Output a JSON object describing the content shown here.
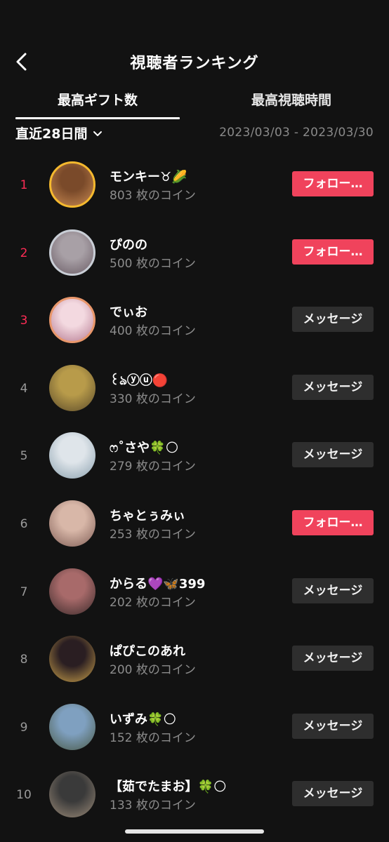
{
  "header": {
    "title": "視聴者ランキング",
    "back_icon": "chevron-left-icon"
  },
  "tabs": [
    {
      "label": "最高ギフト数",
      "active": true
    },
    {
      "label": "最高視聴時間",
      "active": false
    }
  ],
  "filter": {
    "period_label": "直近28日間",
    "date_range": "2023/03/03 - 2023/03/30"
  },
  "colors": {
    "accent": "#fe2c55",
    "follow_button": "#f0435c",
    "message_button": "#2e2e2e",
    "background": "#121212"
  },
  "rows": [
    {
      "rank": "1",
      "name": "モンキー♉🌽",
      "coins": "803 枚のコイン",
      "button": "フォロー…",
      "button_type": "follow",
      "avatar_ring": "gold"
    },
    {
      "rank": "2",
      "name": "ぴのの",
      "coins": "500 枚のコイン",
      "button": "フォロー…",
      "button_type": "follow",
      "avatar_ring": "silver"
    },
    {
      "rank": "3",
      "name": "でぃお",
      "coins": "400 枚のコイン",
      "button": "メッセージ",
      "button_type": "message",
      "avatar_ring": "bronze"
    },
    {
      "rank": "4",
      "name": "꒰ঌⓨⓤ🔴",
      "coins": "330 枚のコイン",
      "button": "メッセージ",
      "button_type": "message",
      "avatar_ring": ""
    },
    {
      "rank": "5",
      "name": "ෆ˚さや🍀🌕",
      "coins": "279 枚のコイン",
      "button": "メッセージ",
      "button_type": "message",
      "avatar_ring": ""
    },
    {
      "rank": "6",
      "name": "ちゃとぅみぃ",
      "coins": "253 枚のコイン",
      "button": "フォロー…",
      "button_type": "follow",
      "avatar_ring": ""
    },
    {
      "rank": "7",
      "name": "からる💜🦋399",
      "coins": "202 枚のコイン",
      "button": "メッセージ",
      "button_type": "message",
      "avatar_ring": ""
    },
    {
      "rank": "8",
      "name": "ぱぴこのあれ",
      "coins": "200 枚のコイン",
      "button": "メッセージ",
      "button_type": "message",
      "avatar_ring": ""
    },
    {
      "rank": "9",
      "name": "いずみ🍀🌕",
      "coins": "152 枚のコイン",
      "button": "メッセージ",
      "button_type": "message",
      "avatar_ring": ""
    },
    {
      "rank": "10",
      "name": "【茹でたまお】🍀🌕",
      "coins": "133 枚のコイン",
      "button": "メッセージ",
      "button_type": "message",
      "avatar_ring": ""
    }
  ]
}
